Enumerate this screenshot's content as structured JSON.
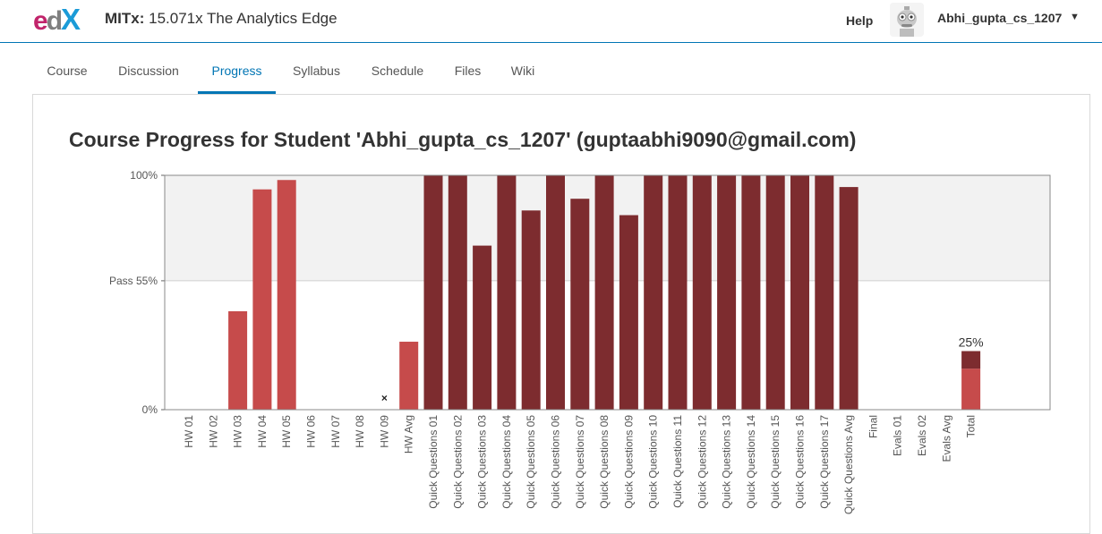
{
  "header": {
    "logo": {
      "e": "e",
      "d": "d",
      "x": "X"
    },
    "course_org": "MITx:",
    "course_name": "15.071x The Analytics Edge",
    "help": "Help",
    "username": "Abhi_gupta_cs_1207",
    "caret": "▼"
  },
  "tabs": [
    {
      "label": "Course",
      "active": false
    },
    {
      "label": "Discussion",
      "active": false
    },
    {
      "label": "Progress",
      "active": true
    },
    {
      "label": "Syllabus",
      "active": false
    },
    {
      "label": "Schedule",
      "active": false
    },
    {
      "label": "Files",
      "active": false
    },
    {
      "label": "Wiki",
      "active": false
    }
  ],
  "heading": "Course Progress for Student 'Abhi_gupta_cs_1207' (guptaabhi9090@gmail.com)",
  "colors": {
    "hw": "#c64b4b",
    "quick": "#7d2c2f",
    "pass_band": "#f2f2f2",
    "accent": "#0075b4"
  },
  "chart_data": {
    "type": "bar",
    "yticks": [
      {
        "value": 100,
        "label": "100%"
      },
      {
        "value": 55,
        "label": "Pass 55%"
      },
      {
        "value": 0,
        "label": "0%"
      }
    ],
    "ylim": [
      0,
      100
    ],
    "categories": [
      "HW 01",
      "HW 02",
      "HW 03",
      "HW 04",
      "HW 05",
      "HW 06",
      "HW 07",
      "HW 08",
      "HW 09",
      "HW Avg",
      "Quick Questions 01",
      "Quick Questions 02",
      "Quick Questions 03",
      "Quick Questions 04",
      "Quick Questions 05",
      "Quick Questions 06",
      "Quick Questions 07",
      "Quick Questions 08",
      "Quick Questions 09",
      "Quick Questions 10",
      "Quick Questions 11",
      "Quick Questions 12",
      "Quick Questions 13",
      "Quick Questions 14",
      "Quick Questions 15",
      "Quick Questions 16",
      "Quick Questions 17",
      "Quick Questions Avg",
      "Final",
      "Evals 01",
      "Evals 02",
      "Evals Avg",
      "Total"
    ],
    "values": [
      0,
      0,
      42,
      94,
      98,
      0,
      0,
      0,
      0,
      29,
      100,
      100,
      70,
      100,
      85,
      100,
      90,
      100,
      83,
      100,
      100,
      100,
      100,
      100,
      100,
      100,
      100,
      95,
      0,
      0,
      0,
      0,
      25
    ],
    "groups": [
      "hw",
      "hw",
      "hw",
      "hw",
      "hw",
      "hw",
      "hw",
      "hw",
      "hw",
      "hw",
      "quick",
      "quick",
      "quick",
      "quick",
      "quick",
      "quick",
      "quick",
      "quick",
      "quick",
      "quick",
      "quick",
      "quick",
      "quick",
      "quick",
      "quick",
      "quick",
      "quick",
      "quick",
      "final",
      "evals",
      "evals",
      "evals",
      "total"
    ],
    "dropped": [
      "HW 09"
    ],
    "dropped_marker": "×",
    "total": {
      "hw_part": 17.5,
      "quick_part": 7.5,
      "label": "25%"
    }
  }
}
